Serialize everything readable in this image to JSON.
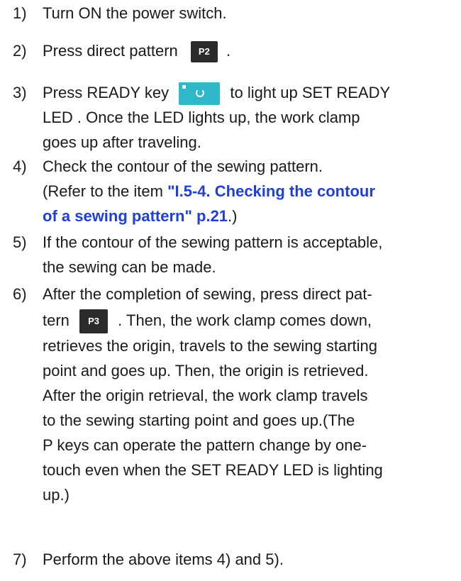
{
  "steps": [
    {
      "num": "1)",
      "text": "Turn ON the power switch."
    },
    {
      "num": "2)",
      "before": "Press direct pattern",
      "key": "P2",
      "after": "."
    },
    {
      "num": "3)",
      "before": "Press READY key",
      "key_name": "ready-key",
      "after": "to light up SET READY",
      "lines": [
        "LED . Once the LED lights up, the work clamp",
        "goes up after traveling."
      ]
    },
    {
      "num": "4)",
      "line1": "Check the contour of the sewing pattern.",
      "line2_pre": "(Refer to the item ",
      "link_part1": "\"I.5-4. Checking the contour",
      "link_part2": "of a sewing pattern\" p.21",
      "line3_post": ".)"
    },
    {
      "num": "5)",
      "lines": [
        "If the contour of the sewing pattern is acceptable,",
        "the sewing can be made."
      ]
    },
    {
      "num": "6)",
      "line1": "After the completion of sewing, press direct pat-",
      "line2_pre": "tern",
      "key": "P3",
      "line2_post": ". Then, the work clamp comes down,",
      "lines": [
        "retrieves the origin, travels to the sewing starting",
        "point and goes up. Then, the origin is retrieved.",
        "After the origin retrieval, the work clamp travels",
        "to the sewing starting point and goes up.(The",
        "P keys can operate the pattern change by one-",
        "touch even when the SET READY LED is lighting",
        "up.)"
      ]
    },
    {
      "num": "7)",
      "text": "Perform the above items 4) and 5)."
    }
  ]
}
